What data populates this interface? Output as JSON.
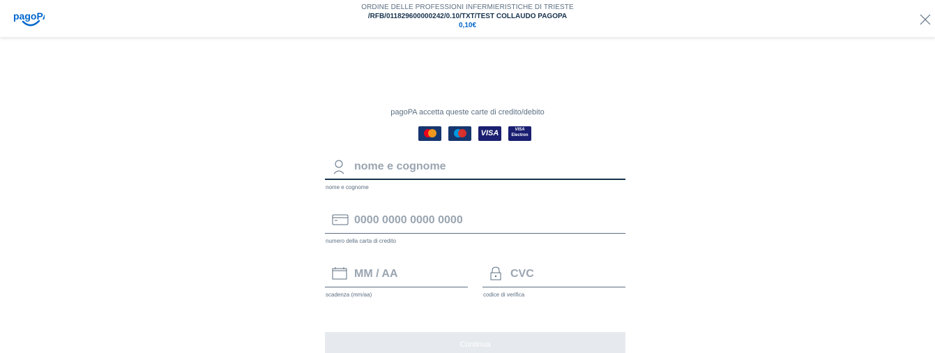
{
  "header": {
    "logo_text": "pagoPA",
    "merchant": "ORDINE DELLE PROFESSIONI INFERMIERISTICHE DI TRIESTE",
    "description": "/RFB/011829600000242/0.10/TXT/TEST COLLAUDO PAGOPA",
    "amount": "0,10€",
    "close_icon": "close-icon"
  },
  "cards": {
    "title": "pagoPA accetta queste carte di credito/debito",
    "brands": [
      "mastercard",
      "maestro",
      "VISA",
      "VISA Electron"
    ],
    "visa_label": "VISA",
    "visa_electron_top": "VISA",
    "visa_electron_bottom": "Electron"
  },
  "form": {
    "name": {
      "placeholder": "nome e cognome",
      "label": "nome e cognome",
      "icon": "user-icon"
    },
    "card_number": {
      "placeholder": "0000 0000 0000 0000",
      "label": "numero della carta di credito",
      "icon": "credit-card-icon"
    },
    "expiry": {
      "placeholder": "MM / AA",
      "label": "scadenza (mm/aa)",
      "icon": "calendar-icon"
    },
    "cvc": {
      "placeholder": "CVC",
      "label": "codice di verifica",
      "icon": "lock-icon"
    },
    "continue_label": "Continua"
  },
  "colors": {
    "brand": "#0066cc",
    "text_dark": "#17324d",
    "text_muted": "#5c6f82",
    "button_disabled": "#e6e9ed"
  }
}
